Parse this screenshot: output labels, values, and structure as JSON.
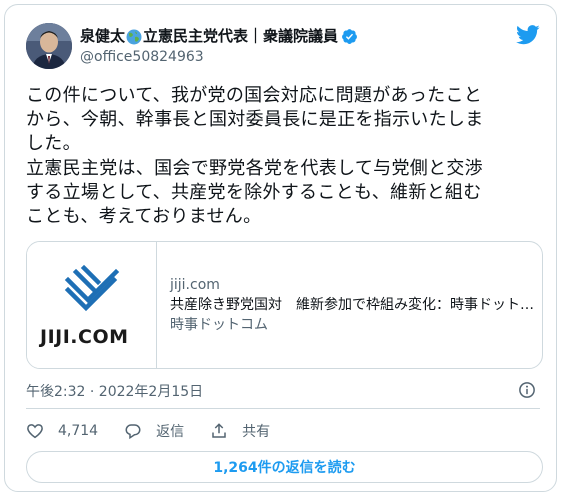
{
  "author": {
    "name_part1": "泉健太",
    "name_part2": "立憲民主党代表｜衆議院議員",
    "handle": "@office50824963"
  },
  "tweet": {
    "lines": [
      "この件について、我が党の国会対応に問題があったこと",
      "から、今朝、幹事長と国対委員長に是正を指示いたしま",
      "した。",
      "立憲民主党は、国会で野党各党を代表して与党側と交渉",
      "する立場として、共産党を除外することも、維新と組む",
      "ことも、考えておりません。"
    ]
  },
  "link_card": {
    "logo_text": "JIJI.COM",
    "domain": "jiji.com",
    "title": "共産除き野党国対　維新参加で枠組み変化：時事ドットコム",
    "source": "時事ドットコム"
  },
  "meta": {
    "timestamp": "午後2:32 · 2022年2月15日"
  },
  "actions": {
    "like_count": "4,714",
    "reply_label": "返信",
    "share_label": "共有"
  },
  "replies_button": {
    "label": "1,264件の返信を読む"
  },
  "colors": {
    "accent": "#1d9bf0",
    "secondary_text": "#536471",
    "border": "#cfd9de",
    "verified": "#1d9bf0",
    "jiji_blue": "#1e6fb5"
  }
}
